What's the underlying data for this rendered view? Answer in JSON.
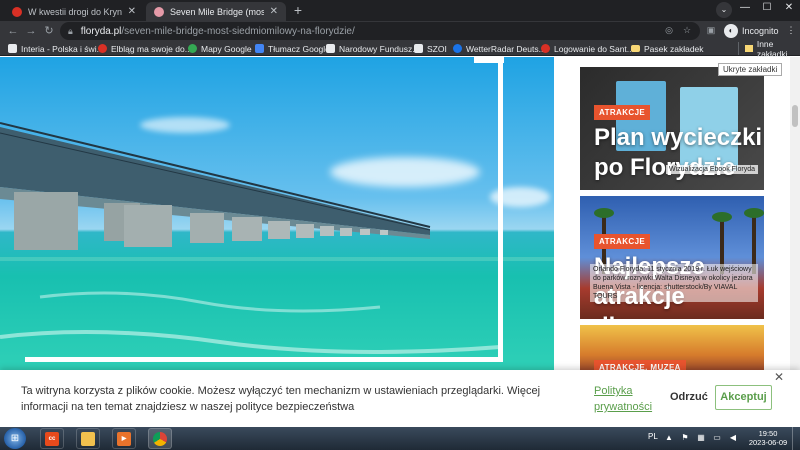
{
  "browser": {
    "tabs": [
      {
        "title": "W kwestii drogi do Krynicy Morskiej",
        "fav_color": "#d93025",
        "active": false
      },
      {
        "title": "Seven Mile Bridge (most siedmiomilowy",
        "fav_color": "#e59aa8",
        "active": true
      }
    ],
    "new_tab_icon": "plus-icon",
    "window_controls": {
      "minimize": "—",
      "maximize": "☐",
      "close": "✕"
    },
    "url": {
      "host": "floryda.pl",
      "path": "/seven-mile-bridge-most-siedmiomilowy-na-florydzie/"
    },
    "incognito_label": "Incognito",
    "bookmarks": [
      {
        "label": "Interia - Polska i świ...",
        "color": "#e8eaed"
      },
      {
        "label": "Elbląg ma swoje do...",
        "color": "#d93025"
      },
      {
        "label": "Mapy Google",
        "color": "#34a853"
      },
      {
        "label": "Tłumacz Google",
        "color": "#4285f4"
      },
      {
        "label": "Narodowy Fundusz...",
        "color": "#e8eaed"
      },
      {
        "label": "SZOI",
        "color": "#e8eaed"
      },
      {
        "label": "WetterRadar Deuts...",
        "color": "#1a73e8"
      },
      {
        "label": "Logowanie do Sant...",
        "color": "#d93025"
      },
      {
        "label": "Pasek zakładek",
        "color": "#f8d775"
      }
    ],
    "other_bookmarks": "Inne zakładki",
    "tooltip": "Ukryte zakładki"
  },
  "sidebar": {
    "cards": [
      {
        "tag": "ATRAKCJE",
        "title": "Plan wycieczki po Florydzie",
        "caption": "Wizualizacja Ebook Floryda"
      },
      {
        "tag": "ATRAKCJE",
        "title": "Najlepsze atrakcje dla",
        "caption": "Orlando Floryda: 11 stycznia 2019 r. Łuk wejściowy do parków rozrywki Walta Disneya w okolicy jeziora Buena Vista - licencja: shutterstock/By VIAVAL TOURS"
      },
      {
        "tag": "ATRAKCJE, MUZEA",
        "title": "",
        "caption": ""
      }
    ]
  },
  "cookie": {
    "text": "Ta witryna korzysta z plików cookie. Możesz wyłączyć ten mechanizm w ustawieniach przeglądarki. Więcej informacji na ten temat znajdziesz w naszej polityce bezpieczeństwa",
    "policy_link": "Polityka prywatności",
    "refuse": "Odrzuć",
    "accept": "Akceptuj",
    "close": "✕"
  },
  "taskbar": {
    "lang": "PL",
    "time": "19:50",
    "date": "2023-06-09"
  }
}
